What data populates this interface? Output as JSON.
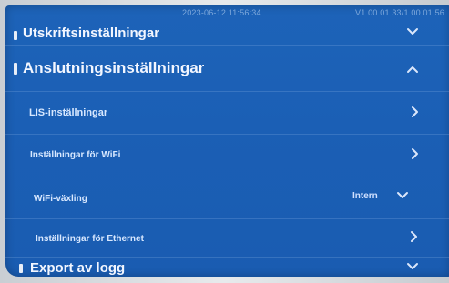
{
  "status": {
    "datetime": "2023-06-12 11:56:34",
    "version": "V1.00.01.33/1.00.01.56"
  },
  "sections": {
    "print_settings": "Utskriftsinställningar",
    "connection_settings": "Anslutningsinställningar",
    "log_export": "Export av logg"
  },
  "items": {
    "lis": "LIS-inställningar",
    "wifi": "Inställningar för WiFi",
    "wifi_switch": "WiFi-växling",
    "wifi_switch_value": "Intern",
    "ethernet": "Inställningar för Ethernet"
  },
  "icons": {
    "expand": "chevron-down-icon",
    "collapse": "chevron-up-icon",
    "navigate": "chevron-right-icon"
  }
}
